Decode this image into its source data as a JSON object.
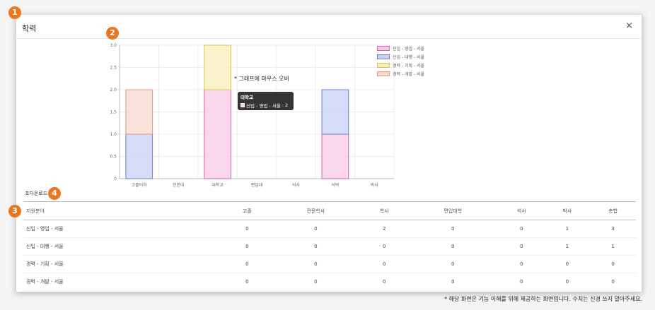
{
  "modal": {
    "title": "학력",
    "close_label": "×",
    "hover_note": "* 그래프에 마우스 오버",
    "subtitle": "초다운로드",
    "footnote": "* 해당 화면은 기능 이해를 위해 제공하는 화면입니다. 수치는 신경 쓰지 말아주세요."
  },
  "badges": [
    "1",
    "2",
    "3",
    "4"
  ],
  "colors": {
    "badge": "#e87722",
    "series": [
      {
        "fill": "#f7c8e6",
        "stroke": "#d06aa8"
      },
      {
        "fill": "#c8d2f5",
        "stroke": "#6f80d0"
      },
      {
        "fill": "#f7eeb8",
        "stroke": "#d8c45a"
      },
      {
        "fill": "#f8d7cd",
        "stroke": "#e09a86"
      }
    ]
  },
  "chart_data": {
    "type": "bar",
    "stacked": true,
    "categories": [
      "고졸이하",
      "전문대",
      "대학교",
      "편입대",
      "석사",
      "석박",
      "박사"
    ],
    "series": [
      {
        "name": "신입 - 영업 - 서울",
        "values": [
          0,
          0,
          2,
          0,
          0,
          1,
          0
        ]
      },
      {
        "name": "신입 - 대행 - 서울",
        "values": [
          1,
          0,
          0,
          0,
          0,
          1,
          0
        ]
      },
      {
        "name": "경력 - 기획 - 서울",
        "values": [
          0,
          0,
          1,
          0,
          0,
          0,
          0
        ]
      },
      {
        "name": "경력 - 개발 - 서울",
        "values": [
          1,
          0,
          0,
          0,
          0,
          0,
          0
        ]
      }
    ],
    "y_ticks": [
      "0",
      "0.5",
      "1.0",
      "1.5",
      "2.0",
      "2.5",
      "3.0"
    ],
    "ylim": [
      0,
      3
    ],
    "grid": true,
    "legend": "right",
    "tooltip": {
      "title": "대학교",
      "series": "신입 - 영업 - 서울",
      "value": "2"
    }
  },
  "table": {
    "headers": [
      "지원분야",
      "고졸",
      "전문학사",
      "학사",
      "편입대학",
      "석사",
      "박사",
      "총합"
    ],
    "rows": [
      [
        "신입 - 영업 - 서울",
        "0",
        "0",
        "2",
        "0",
        "0",
        "1",
        "3"
      ],
      [
        "신입 - 대행 - 서울",
        "0",
        "0",
        "0",
        "0",
        "0",
        "1",
        "1"
      ],
      [
        "경력 - 기획 - 서울",
        "0",
        "0",
        "0",
        "0",
        "0",
        "0",
        "0"
      ],
      [
        "경력 - 개발 - 서울",
        "0",
        "0",
        "0",
        "0",
        "0",
        "0",
        "0"
      ]
    ]
  }
}
